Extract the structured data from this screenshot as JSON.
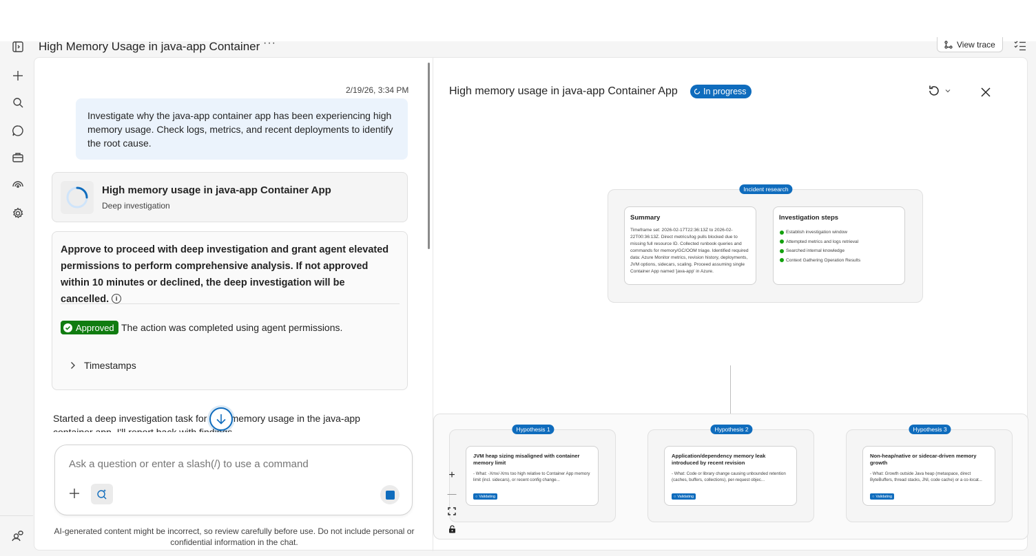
{
  "header": {
    "title": "High Memory Usage in java-app Container",
    "more_label": "···",
    "view_trace_label": "View trace"
  },
  "rail": {
    "items": [
      "collapse-icon",
      "new-icon",
      "search-icon",
      "chat-icon",
      "briefcase-icon",
      "monitor-icon",
      "settings-icon"
    ],
    "footer_icon": "people-icon"
  },
  "chat": {
    "timestamp": "2/19/26, 3:34 PM",
    "user_message": "Investigate why the java-app container app has been experiencing high memory usage. Check logs, metrics, and recent deployments to identify the root cause.",
    "task": {
      "title": "High memory usage in java-app Container App",
      "subtitle": "Deep investigation"
    },
    "approval": {
      "text": "Approve to proceed with deep investigation and grant agent elevated permissions to perform comprehensive analysis. If not approved within 10 minutes or declined, the deep investigation will be cancelled.",
      "badge": "Approved",
      "result": "The action was completed using agent permissions.",
      "timestamps_label": "Timestamps"
    },
    "started_text": "Started a deep investigation task for high memory usage in the java-app container app. I'll report back with findings.",
    "composer": {
      "placeholder": "Ask a question or enter a slash(/) to use a command"
    },
    "disclaimer": "AI-generated content might be incorrect, so review carefully before use. Do not include personal or confidential information in the chat."
  },
  "panel": {
    "title": "High memory usage in java-app Container App",
    "status": "In progress",
    "incident_label": "Incident research",
    "summary": {
      "title": "Summary",
      "text": "Timeframe set: 2026-02-17T22:36:13Z to 2026-02-22T00:36:13Z. Direct metrics/log pulls blocked due to missing full resource ID. Collected runbook queries and commands for memory/GC/OOM triage. Identified required data: Azure Monitor metrics, revision history, deployments, JVM options, sidecars, scaling. Proceed assuming single Container App named 'java-app' in Azure."
    },
    "steps": {
      "title": "Investigation steps",
      "items": [
        "Establish investigation window",
        "Attempted metrics and logs retrieval",
        "Searched internal knowledge",
        "Context Gathering Operation Results"
      ]
    },
    "hypotheses": [
      {
        "label": "Hypothesis 1",
        "title": "JVM heap sizing misaligned with container memory limit",
        "desc": "- What: -Xmx/-Xms too high relative to Container App memory limit (incl. sidecars), or recent config change...",
        "status": "Validating"
      },
      {
        "label": "Hypothesis 2",
        "title": "Application/dependency memory leak introduced by recent revision",
        "desc": "- What: Code or library change causing unbounded retention (caches, buffers, collections), per-request objec...",
        "status": "Validating"
      },
      {
        "label": "Hypothesis 3",
        "title": "Non-heap/native or sidecar-driven memory growth",
        "desc": "- What: Growth outside Java heap (metaspace, direct ByteBuffers, thread stacks, JNI, code cache) or a co-locat...",
        "status": "Validating"
      }
    ],
    "zoom": {
      "in": "+",
      "out": "—"
    }
  },
  "colors": {
    "accent": "#0f6cbd",
    "approved": "#107c10",
    "user_bubble": "#ebf3fc",
    "step_dot": "#13a10e"
  }
}
